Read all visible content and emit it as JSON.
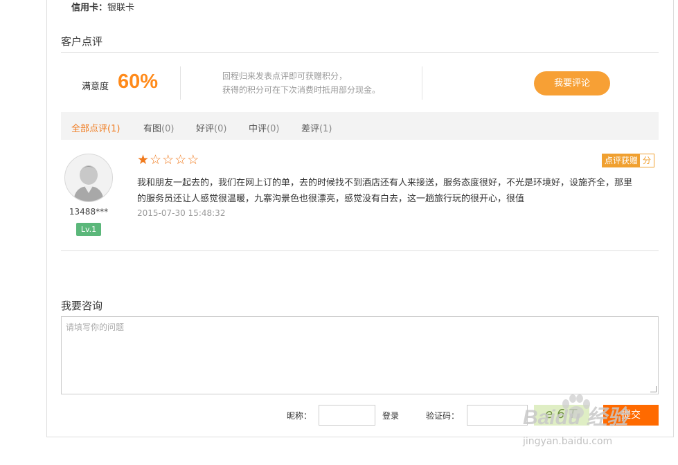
{
  "payment": {
    "label": "信用卡：",
    "value": "银联卡"
  },
  "reviews": {
    "title": "客户点评",
    "satisfaction_label": "满意度",
    "satisfaction_value": "60%",
    "note_line1": "回程归来发表点评即可获赠积分，",
    "note_line2": "获得的积分可在下次消费时抵用部分现金。",
    "write_button": "我要评论",
    "tabs": [
      {
        "label": "全部点评",
        "count": "(1)",
        "active": true
      },
      {
        "label": "有图",
        "count": "(0)"
      },
      {
        "label": "好评",
        "count": "(0)"
      },
      {
        "label": "中评",
        "count": "(0)"
      },
      {
        "label": "差评",
        "count": "(1)"
      }
    ],
    "items": [
      {
        "username": "13488***",
        "level": "Lv.1",
        "rating": 1,
        "rating_max": 5,
        "badge_left": "点评获赠",
        "badge_right": "分",
        "text": "我和朋友一起去的，我们在网上订的单，去的时候找不到酒店还有人来接送，服务态度很好，不光是环境好，设施齐全，那里的服务员还让人感觉很温暖，九寨沟景色也很漂亮，感觉没有白去，这一趟旅行玩的很开心，很值",
        "date": "2015-07-30 15:48:32"
      }
    ]
  },
  "consult": {
    "title": "我要咨询",
    "placeholder": "请填写你的问题",
    "nickname_label": "昵称：",
    "login_link": "登录",
    "captcha_label": "验证码：",
    "captcha_text": "e6T",
    "submit_label": "提交"
  },
  "watermark": {
    "main": "Baidu 经验",
    "sub": "jingyan.baidu.com"
  },
  "colors": {
    "accent": "#f07a1d",
    "button": "#f7a035",
    "submit": "#ff6a00",
    "level": "#5bb77a"
  }
}
